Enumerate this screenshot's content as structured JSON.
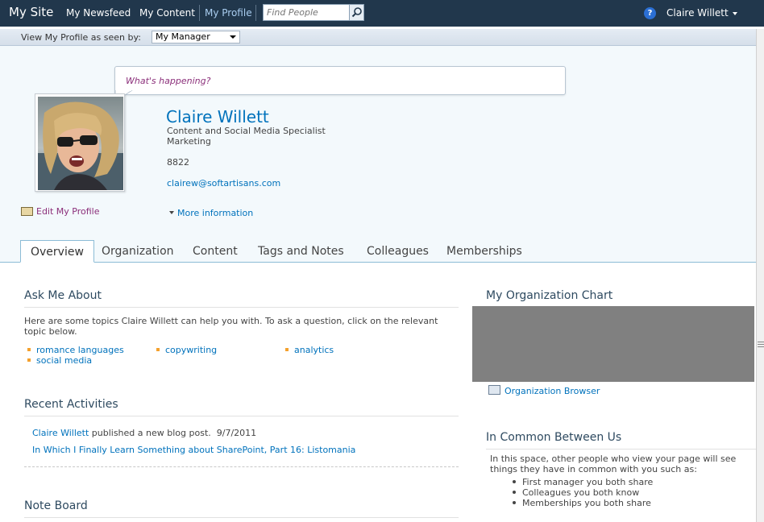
{
  "topbar": {
    "site_title": "My Site",
    "nav": [
      "My Newsfeed",
      "My Content",
      "My Profile"
    ],
    "search_placeholder": "Find People",
    "help": "?",
    "user": "Claire Willett"
  },
  "viewbar": {
    "label": "View My Profile as seen by:",
    "selected": "My Manager"
  },
  "status": {
    "placeholder": "What's happening?"
  },
  "profile": {
    "name": "Claire Willett",
    "title": "Content and Social Media Specialist",
    "department": "Marketing",
    "phone": "8822",
    "email": "clairew@softartisans.com",
    "edit_label": "Edit My Profile",
    "more_label": "More information"
  },
  "tabs": [
    "Overview",
    "Organization",
    "Content",
    "Tags and Notes",
    "Colleagues",
    "Memberships"
  ],
  "ask_me": {
    "title": "Ask Me About",
    "intro_1": "Here are some topics Claire Willett can help you with. To ask a question, click on the relevant",
    "intro_2": "topic below.",
    "topics": [
      "romance languages",
      "copywriting",
      "analytics",
      "social media"
    ]
  },
  "recent": {
    "title": "Recent Activities",
    "actor": "Claire Willett",
    "action": "published a new blog post.",
    "date": "9/7/2011",
    "post_link": "In Which I Finally Learn Something about SharePoint, Part 16: Listomania"
  },
  "note_board": {
    "title": "Note Board"
  },
  "org": {
    "title": "My Organization Chart",
    "browser_link": "Organization Browser"
  },
  "common": {
    "title": "In Common Between Us",
    "intro_1": "In this space, other people who view your page will see",
    "intro_2": "things they have in common with you such as:",
    "items": [
      "First manager you both share",
      "Colleagues you both know",
      "Memberships you both share"
    ]
  },
  "colors": {
    "topbar": "#21374c",
    "link": "#0072bc",
    "accent_magenta": "#8b2f7a",
    "bullet_orange": "#f4a12e"
  }
}
